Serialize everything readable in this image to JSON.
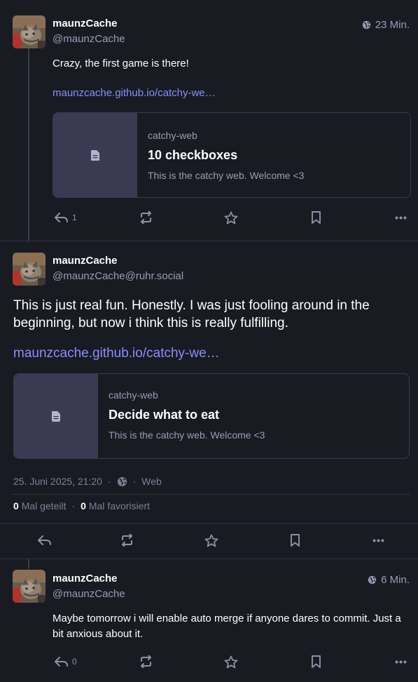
{
  "colors": {
    "background": "#191b22",
    "accent_link": "#8c8dff",
    "muted": "#9a9cb6",
    "card_thumb": "#3a3a52"
  },
  "posts": [
    {
      "display_name": "maunzCache",
      "handle": "@maunzCache",
      "time": "23 Min.",
      "visibility_icon": "globe-icon",
      "text": "Crazy, the first game is there!",
      "link": "maunzcache.github.io/catchy-we…",
      "card": {
        "provider": "catchy-web",
        "title": "10 checkboxes",
        "description": "This is the catchy web. Welcome <3",
        "thumb_icon": "document-icon"
      },
      "reply_count": "1"
    },
    {
      "display_name": "maunzCache",
      "handle": "@maunzCache@ruhr.social",
      "text": "This is just real fun. Honestly. I was just fooling around in the beginning, but now i think this is really fulfilling.",
      "link": "maunzcache.github.io/catchy-we…",
      "card": {
        "provider": "catchy-web",
        "title": "Decide what to eat",
        "description": "This is the catchy web. Welcome <3",
        "thumb_icon": "document-icon"
      },
      "datetime": "25. Juni 2025, 21:20",
      "separator": "·",
      "application": "Web",
      "reblogs_count": "0",
      "reblogs_label": "Mal geteilt",
      "favourites_count": "0",
      "favourites_label": "Mal favorisiert"
    },
    {
      "display_name": "maunzCache",
      "handle": "@maunzCache",
      "time": "6 Min.",
      "visibility_icon": "globe-icon",
      "text": "Maybe tomorrow i will enable auto merge if anyone dares to commit. Just a bit anxious about it.",
      "reply_count": "0"
    }
  ]
}
